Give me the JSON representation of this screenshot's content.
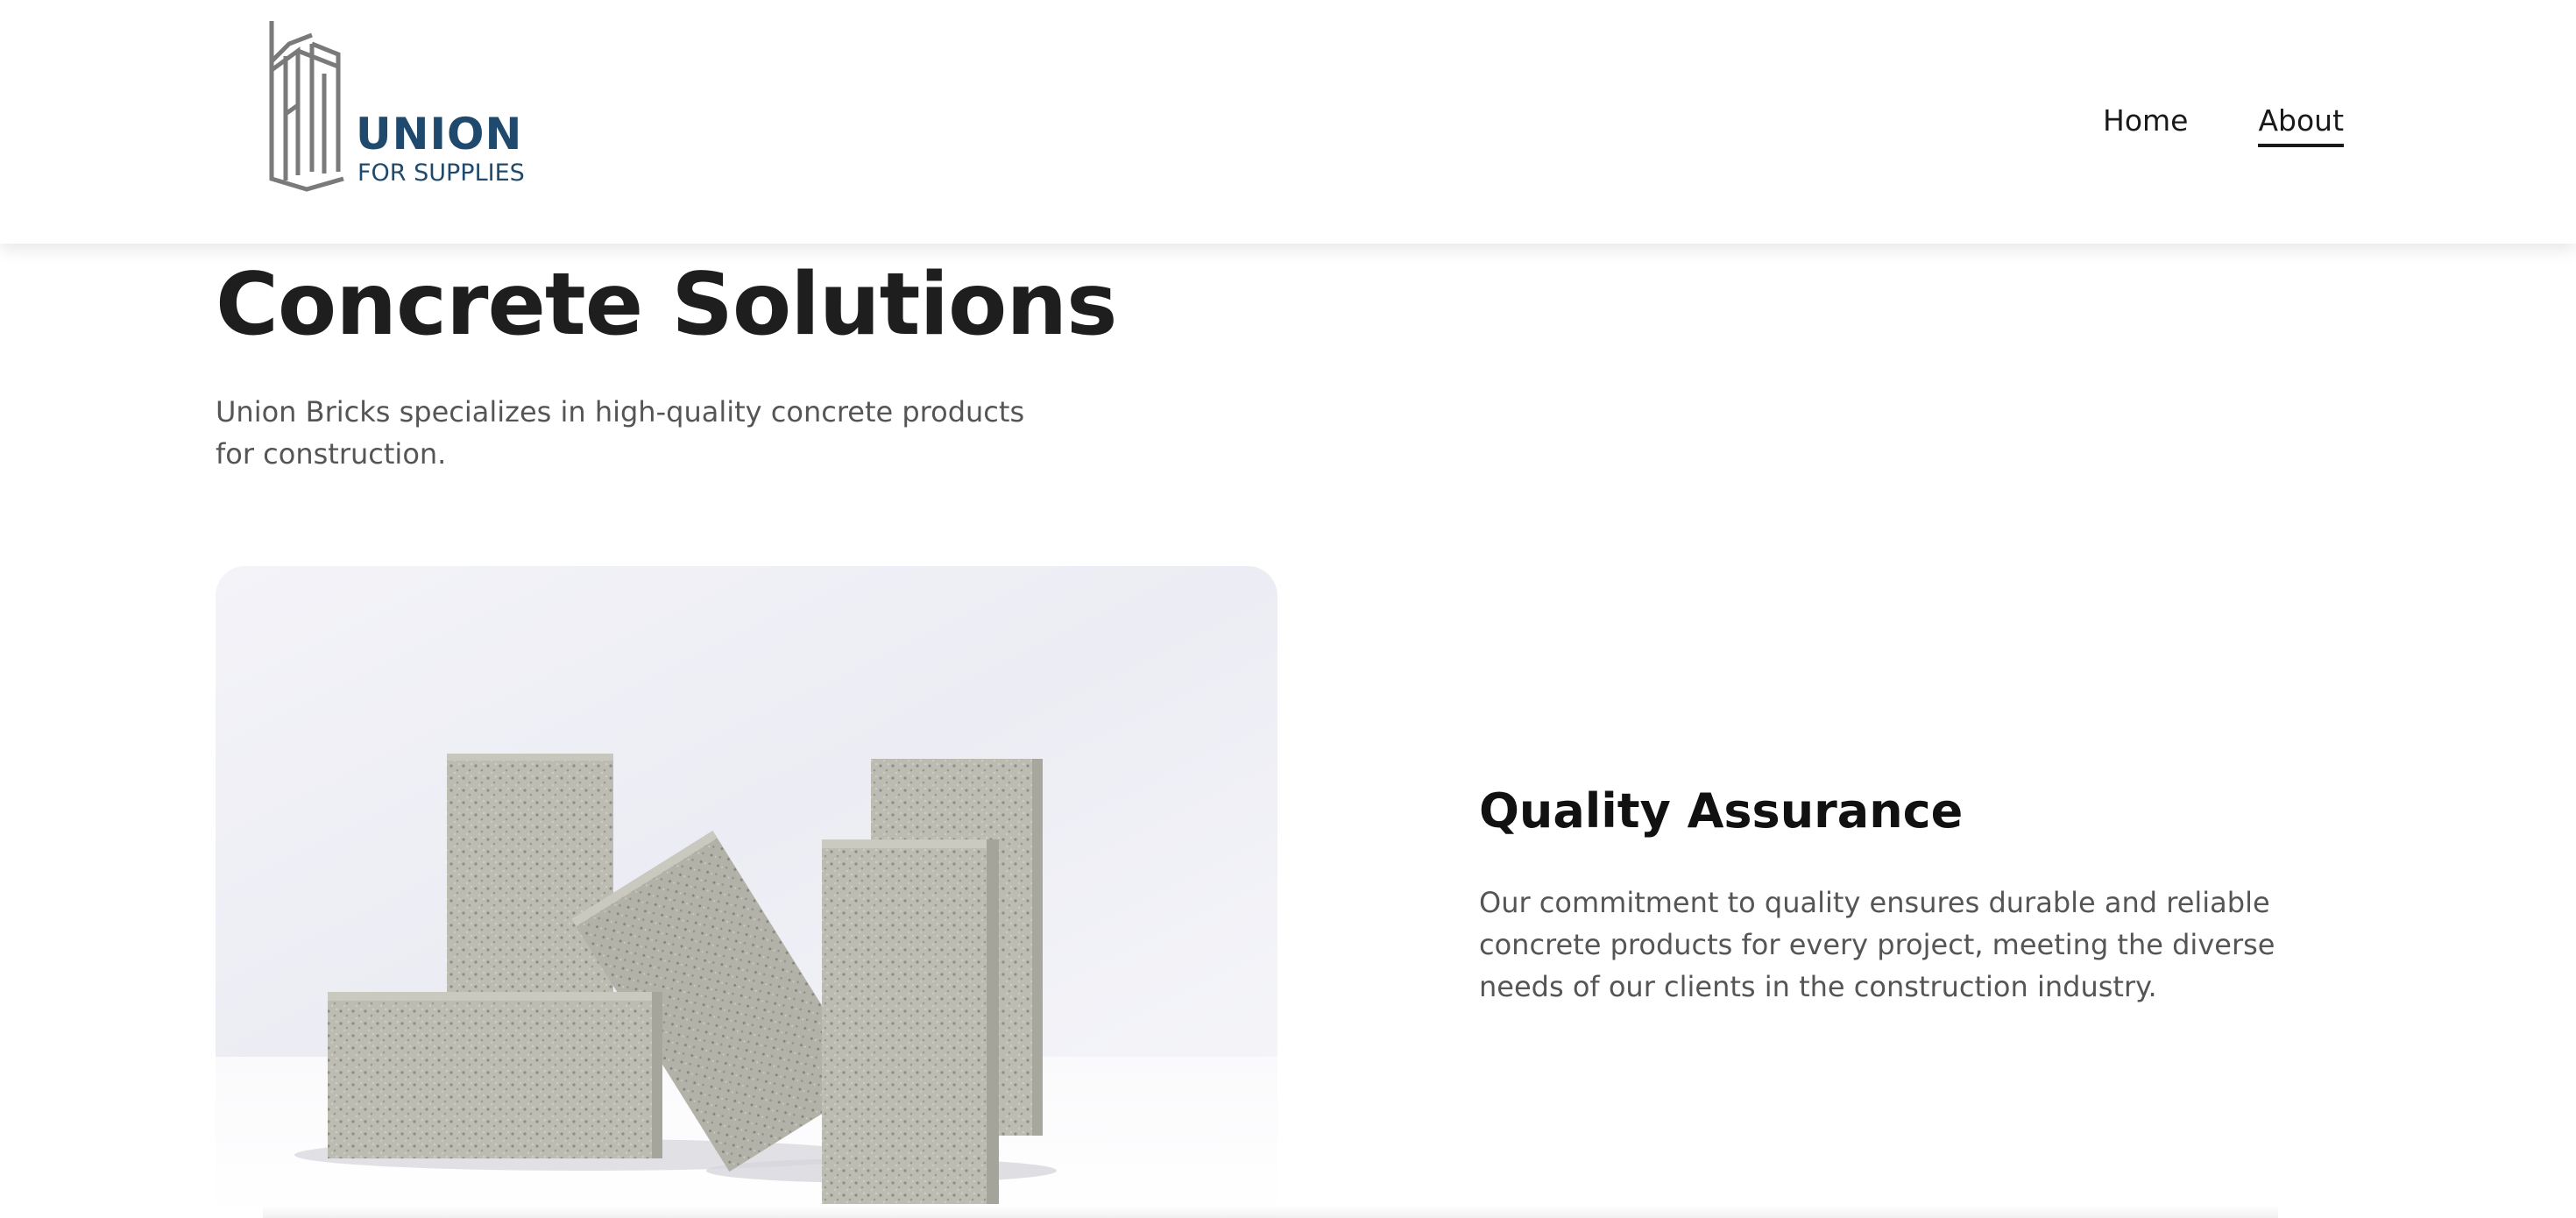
{
  "header": {
    "logo": {
      "wordmark": "UNION",
      "tagline": "FOR SUPPLIES",
      "icon": "building-logo-icon"
    },
    "nav": [
      {
        "label": "Home",
        "active": false
      },
      {
        "label": "About",
        "active": true
      }
    ]
  },
  "hero": {
    "title": "Concrete Solutions",
    "description": "Union Bricks specializes in high-quality concrete products for construction."
  },
  "image": {
    "subject": "concrete-bricks-image"
  },
  "feature": {
    "title": "Quality Assurance",
    "description": "Our commitment to quality ensures durable and reliable concrete products for every project, meeting the diverse needs of our clients in the construction industry."
  },
  "colors": {
    "brand": "#1f4a6e",
    "logo_gray": "#7a7a7a",
    "text_dark": "#1e1e1e",
    "text_muted": "#555555",
    "brick": "#b9b8ae"
  }
}
